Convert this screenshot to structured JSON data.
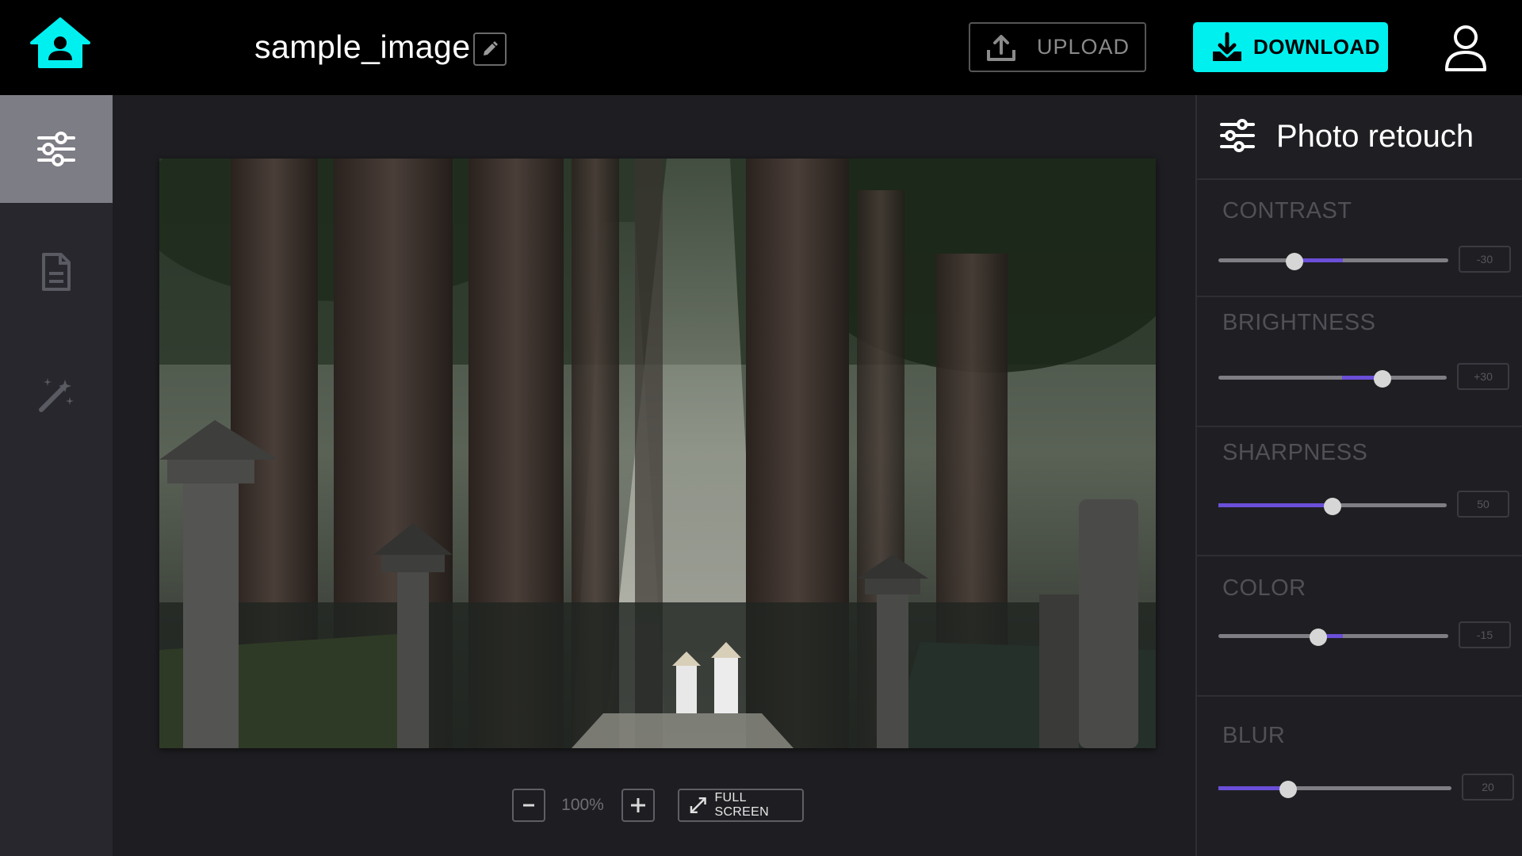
{
  "header": {
    "file_name": "sample_image",
    "upload_label": "UPLOAD",
    "download_label": "DOWNLOAD",
    "accent_color": "#00f0f0"
  },
  "sidebar": {
    "items": [
      {
        "icon": "sliders-icon",
        "active": true
      },
      {
        "icon": "document-icon",
        "active": false
      },
      {
        "icon": "magic-wand-icon",
        "active": false
      }
    ]
  },
  "canvas": {
    "zoom_level": "100%",
    "fullscreen_label": "FULL SCREEN"
  },
  "panel": {
    "title": "Photo retouch",
    "accent_color": "#6b4fd8",
    "adjustments": [
      {
        "label": "CONTRAST",
        "value": "-30",
        "level": -0.3
      },
      {
        "label": "BRIGHTNESS",
        "value": "+30",
        "level": 0.3
      },
      {
        "label": "SHARPNESS",
        "value": "50",
        "level": 0.5
      },
      {
        "label": "COLOR",
        "value": "-15",
        "level": -0.15
      },
      {
        "label": "BLUR",
        "value": "20",
        "level": 0.2
      }
    ]
  }
}
